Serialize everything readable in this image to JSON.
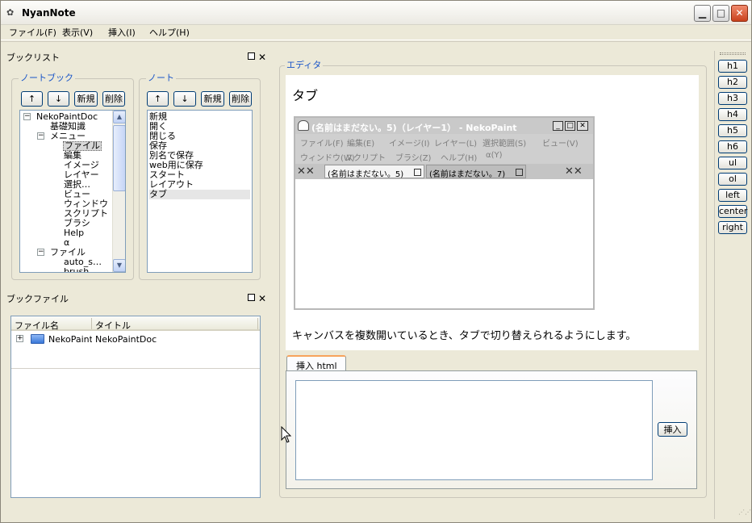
{
  "app": {
    "title": "NyanNote"
  },
  "menu": [
    "ファイル(F)",
    "表示(V)",
    "挿入(I)",
    "ヘルプ(H)"
  ],
  "booklist": {
    "title": "ブックリスト",
    "notebook_group": {
      "title": "ノートブック",
      "buttons": [
        "↑",
        "↓",
        "新規",
        "削除"
      ],
      "tree": [
        {
          "label": "NekoPaintDoc",
          "level": 0,
          "expander": "−"
        },
        {
          "label": "基礎知識",
          "level": 1,
          "expander": ""
        },
        {
          "label": "メニュー",
          "level": 1,
          "expander": "−"
        },
        {
          "label": "ファイル",
          "level": 2,
          "expander": "",
          "selected": true
        },
        {
          "label": "編集",
          "level": 2,
          "expander": ""
        },
        {
          "label": "イメージ",
          "level": 2,
          "expander": ""
        },
        {
          "label": "レイヤー",
          "level": 2,
          "expander": ""
        },
        {
          "label": "選択…",
          "level": 2,
          "expander": ""
        },
        {
          "label": "ビュー",
          "level": 2,
          "expander": ""
        },
        {
          "label": "ウィンドウ",
          "level": 2,
          "expander": ""
        },
        {
          "label": "スクリプト",
          "level": 2,
          "expander": ""
        },
        {
          "label": "ブラシ",
          "level": 2,
          "expander": ""
        },
        {
          "label": "Help",
          "level": 2,
          "expander": ""
        },
        {
          "label": "α",
          "level": 2,
          "expander": ""
        },
        {
          "label": "ファイル",
          "level": 1,
          "expander": "−"
        },
        {
          "label": "auto_s…",
          "level": 2,
          "expander": ""
        },
        {
          "label": "brush…",
          "level": 2,
          "expander": ""
        }
      ]
    },
    "note_group": {
      "title": "ノート",
      "buttons": [
        "↑",
        "↓",
        "新規",
        "削除"
      ],
      "items": [
        "新規",
        "開く",
        "閉じる",
        "保存",
        "別名で保存",
        "web用に保存",
        "スタート",
        "レイアウト",
        "タブ"
      ],
      "selected_index": 8
    }
  },
  "bookfile": {
    "title": "ブックファイル",
    "columns": [
      "ファイル名",
      "タイトル"
    ],
    "rows": [
      {
        "expander": "+",
        "icon": "folder-icon",
        "filename": "NekoPaintI",
        "title": "NekoPaintDoc"
      }
    ]
  },
  "editor": {
    "title": "エディタ",
    "heading": "タブ",
    "body_text": "キャンバスを複数開いているとき、タブで切り替えられるようにします。",
    "embedded": {
      "title": "(名前はまだない。5)（レイヤー1） - NekoPaint",
      "menu": [
        "ファイル(F)",
        "編集(E)",
        "イメージ(I)",
        "レイヤー(L)",
        "選択範囲(S)",
        "ビュー(V)",
        "ウィンドウ(W)",
        "スクリプト",
        "ブラシ(Z)",
        "ヘルプ(H)",
        "α(Y)"
      ],
      "tabs": [
        "(名前はまだない。5)",
        "(名前はまだない。7)"
      ],
      "active_tab": 0
    },
    "insert_tab": {
      "label": "挿入 html",
      "textarea_value": "",
      "button": "挿入"
    }
  },
  "toolbox": [
    "h1",
    "h2",
    "h3",
    "h4",
    "h5",
    "h6",
    "ul",
    "ol",
    "left",
    "center",
    "right"
  ]
}
